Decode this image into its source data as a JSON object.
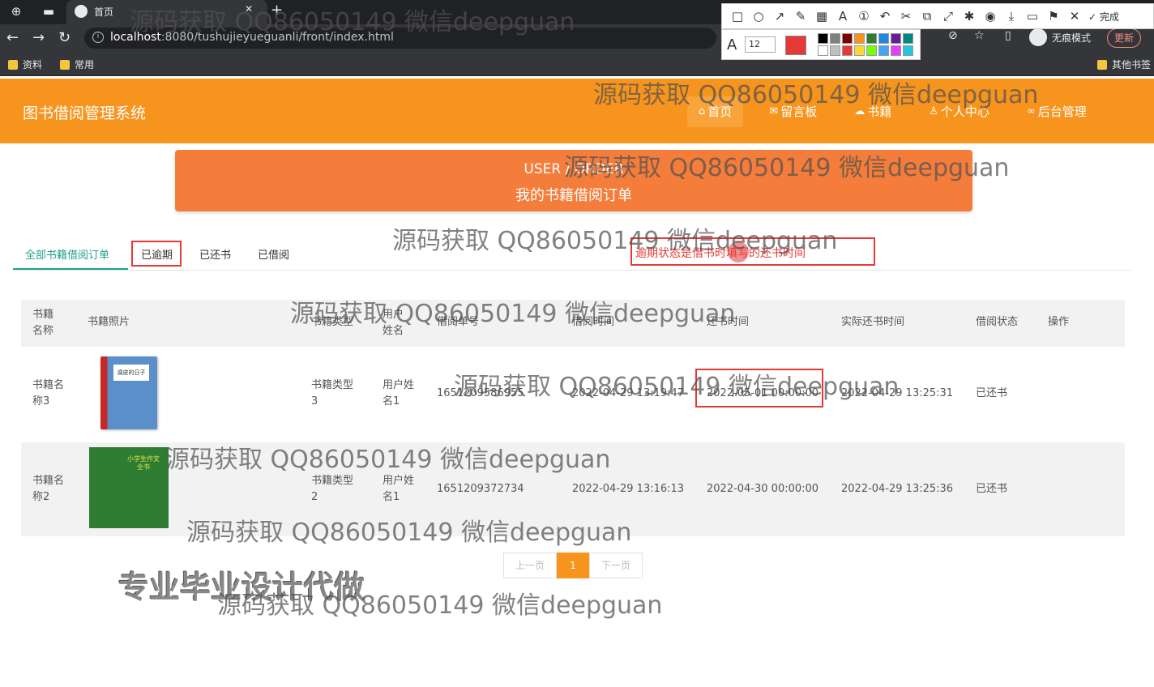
{
  "browser": {
    "tab_title": "首页",
    "url_host": "localhost",
    "url_rest": ":8080/tushujieyueguanli/front/index.html",
    "incognito_label": "无痕模式",
    "update_label": "更新",
    "bookmarks": [
      "资料",
      "常用"
    ],
    "other_bookmarks": "其他书签"
  },
  "annotation_toolbar": {
    "done_label": "完成",
    "font_size": "12",
    "current_color": "#e53935"
  },
  "site": {
    "title": "图书借阅管理系统",
    "nav": [
      {
        "label": "首页",
        "icon": "home-icon"
      },
      {
        "label": "留言板",
        "icon": "mail-icon"
      },
      {
        "label": "书籍",
        "icon": "book-icon"
      },
      {
        "label": "个人中心",
        "icon": "user-icon"
      },
      {
        "label": "后台管理",
        "icon": "link-icon"
      }
    ]
  },
  "banner": {
    "en": "USER / ORDER",
    "cn": "我的书籍借阅订单"
  },
  "tabs": [
    "全部书籍借阅订单",
    "已逾期",
    "已还书",
    "已借阅"
  ],
  "note": "逾期状态是借书时填写的还书时间",
  "table": {
    "headers": [
      "书籍名称",
      "书籍照片",
      "书籍类型",
      "用户姓名",
      "借阅单号",
      "借阅时间",
      "还书时间",
      "实际还书时间",
      "借阅状态",
      "操作"
    ],
    "rows": [
      {
        "name": "书籍名称3",
        "type": "书籍类型3",
        "user": "用户姓名1",
        "order_no": "1651209586955",
        "borrow_time": "2022-04-29 13:19:47",
        "return_time": "2022-05-01 00:00:00",
        "actual_return": "2022-04-29 13:25:31",
        "status": "已还书",
        "cover_text": "调皮的日子"
      },
      {
        "name": "书籍名称2",
        "type": "书籍类型2",
        "user": "用户姓名1",
        "order_no": "1651209372734",
        "borrow_time": "2022-04-29 13:16:13",
        "return_time": "2022-04-30 00:00:00",
        "actual_return": "2022-04-29 13:25:36",
        "status": "已还书",
        "cover_text": "小学生作文全书"
      }
    ]
  },
  "pager": {
    "prev": "上一页",
    "current": "1",
    "next": "下一页"
  },
  "watermark": "源码获取 QQ86050149 微信deepguan",
  "promo": "专业毕业设计代做"
}
